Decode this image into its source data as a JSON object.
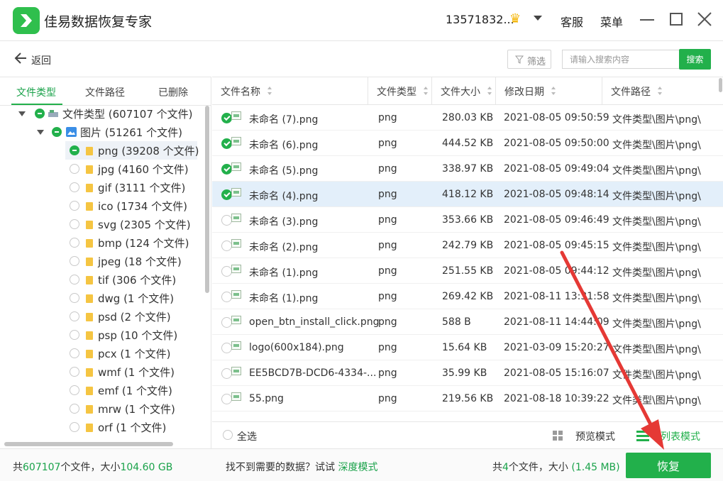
{
  "app": {
    "title": "佳易数据恢复专家"
  },
  "header": {
    "user": "13571832...",
    "service": "客服",
    "menu": "菜单"
  },
  "toolbar": {
    "back_label": "返回",
    "filter_label": "筛选",
    "search_placeholder": "请输入搜索内容",
    "search_button": "搜索"
  },
  "left_tabs": [
    "文件类型",
    "文件路径",
    "已删除"
  ],
  "tree": [
    {
      "label": "文件类型 (607107 个文件)"
    },
    {
      "label": "图片 (51261 个文件)"
    },
    {
      "label": "png (39208 个文件)"
    },
    {
      "label": "jpg (4160 个文件)"
    },
    {
      "label": "gif (3111 个文件)"
    },
    {
      "label": "ico (1734 个文件)"
    },
    {
      "label": "svg (2305 个文件)"
    },
    {
      "label": "bmp (124 个文件)"
    },
    {
      "label": "jpeg (18 个文件)"
    },
    {
      "label": "tif (306 个文件)"
    },
    {
      "label": "dwg (1 个文件)"
    },
    {
      "label": "psd (2 个文件)"
    },
    {
      "label": "psp (10 个文件)"
    },
    {
      "label": "pcx (1 个文件)"
    },
    {
      "label": "wmf (1 个文件)"
    },
    {
      "label": "emf (1 个文件)"
    },
    {
      "label": "mrw (1 个文件)"
    },
    {
      "label": "orf (1 个文件)"
    }
  ],
  "columns": [
    "文件名称",
    "文件类型",
    "文件大小",
    "修改日期",
    "文件路径"
  ],
  "rows": [
    {
      "checked": true,
      "name": "未命名 (7).png",
      "type": "png",
      "size": "280.03 KB",
      "date": "2021-08-05 09:50:59",
      "path": "文件类型\\图片\\png\\"
    },
    {
      "checked": true,
      "name": "未命名 (6).png",
      "type": "png",
      "size": "444.52 KB",
      "date": "2021-08-05 09:50:00",
      "path": "文件类型\\图片\\png\\"
    },
    {
      "checked": true,
      "name": "未命名 (5).png",
      "type": "png",
      "size": "338.97 KB",
      "date": "2021-08-05 09:49:04",
      "path": "文件类型\\图片\\png\\"
    },
    {
      "checked": true,
      "name": "未命名 (4).png",
      "type": "png",
      "size": "418.12 KB",
      "date": "2021-08-05 09:48:14",
      "path": "文件类型\\图片\\png\\"
    },
    {
      "checked": false,
      "name": "未命名 (3).png",
      "type": "png",
      "size": "353.66 KB",
      "date": "2021-08-05 09:46:49",
      "path": "文件类型\\图片\\png\\"
    },
    {
      "checked": false,
      "name": "未命名 (2).png",
      "type": "png",
      "size": "242.79 KB",
      "date": "2021-08-05 09:45:15",
      "path": "文件类型\\图片\\png\\"
    },
    {
      "checked": false,
      "name": "未命名 (1).png",
      "type": "png",
      "size": "251.55 KB",
      "date": "2021-08-05 09:44:12",
      "path": "文件类型\\图片\\png\\"
    },
    {
      "checked": false,
      "name": "未命名 (1).png",
      "type": "png",
      "size": "269.42 KB",
      "date": "2021-08-11 13:31:58",
      "path": "文件类型\\图片\\png\\"
    },
    {
      "checked": false,
      "name": "open_btn_install_click.png",
      "type": "png",
      "size": "588 B",
      "date": "2021-08-11 14:44:09",
      "path": "文件类型\\图片\\png\\"
    },
    {
      "checked": false,
      "name": "logo(600x184).png",
      "type": "png",
      "size": "15.64 KB",
      "date": "2021-03-09 15:20:27",
      "path": "文件类型\\图片\\png\\"
    },
    {
      "checked": false,
      "name": "EE5BCD7B-DCD6-4334-...",
      "type": "png",
      "size": "35.99 KB",
      "date": "2021-08-05 15:16:07",
      "path": "文件类型\\图片\\png\\"
    },
    {
      "checked": false,
      "name": "55.png",
      "type": "png",
      "size": "219.56 KB",
      "date": "2021-08-18 10:39:22",
      "path": "文件类型\\图片\\png\\"
    }
  ],
  "footer": {
    "select_all": "全选",
    "preview_mode": "预览模式",
    "list_mode": "列表模式"
  },
  "status": {
    "total_prefix": "共",
    "total_count": "607107",
    "total_mid": "个文件，大小",
    "total_size": "104.60 GB",
    "hint": "找不到需要的数据？试试",
    "deep_mode": "深度模式",
    "sel_prefix": "共",
    "sel_count": "4",
    "sel_mid": "个文件，大小",
    "sel_size": "(1.45 MB)",
    "recover": "恢复"
  },
  "colors": {
    "accent": "#22b04b",
    "row_highlight": "#e3effa",
    "annotation": "#e53935"
  }
}
